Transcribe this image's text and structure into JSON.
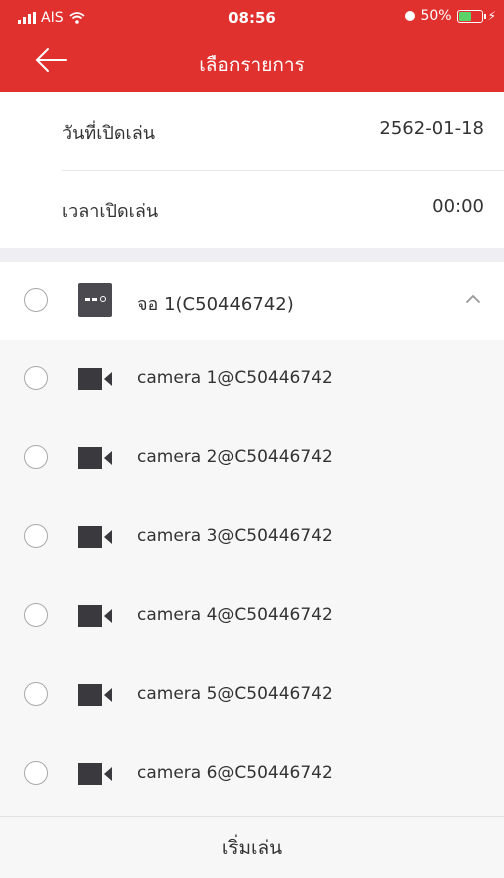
{
  "status_bar": {
    "carrier": "AIS",
    "time": "08:56",
    "battery_text": "50%"
  },
  "header": {
    "title": "เลือกรายการ"
  },
  "settings": {
    "date_label": "วันที่เปิดเล่น",
    "date_value": "2562-01-18",
    "time_label": "เวลาเปิดเล่น",
    "time_value": "00:00"
  },
  "device": {
    "name": "จอ 1(C50446742)",
    "expanded": true,
    "icon": "dvr-icon"
  },
  "cameras": [
    {
      "label": "camera 1@C50446742",
      "icon": "video-camera-icon"
    },
    {
      "label": "camera 2@C50446742",
      "icon": "video-camera-icon"
    },
    {
      "label": "camera 3@C50446742",
      "icon": "video-camera-icon"
    },
    {
      "label": "camera 4@C50446742",
      "icon": "video-camera-icon"
    },
    {
      "label": "camera 5@C50446742",
      "icon": "video-camera-icon"
    },
    {
      "label": "camera 6@C50446742",
      "icon": "video-camera-icon"
    }
  ],
  "footer": {
    "start_label": "เริ่มเล่น"
  },
  "colors": {
    "header": "#e0312f",
    "list_bg": "#f7f7f7",
    "section_gap": "#eeeef3",
    "battery_fill": "#5ad469"
  }
}
